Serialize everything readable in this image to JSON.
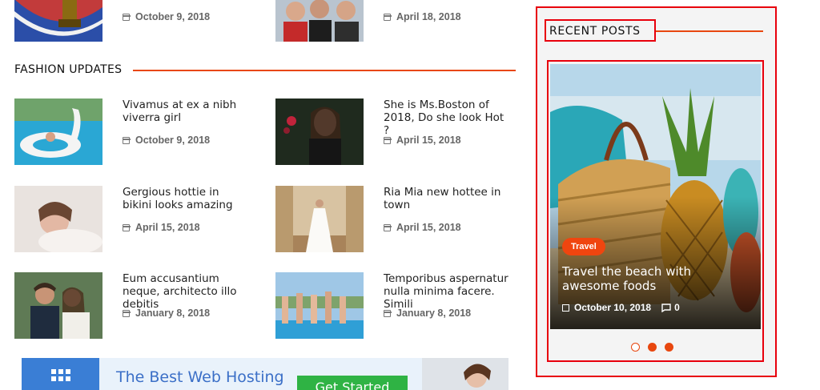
{
  "top_row": [
    {
      "date": "October 9, 2018"
    },
    {
      "date": "April 18, 2018"
    }
  ],
  "fashion": {
    "heading": "FASHION UPDATES",
    "posts": [
      {
        "title": "Vivamus at ex a nibh viverra girl",
        "date": "October 9, 2018"
      },
      {
        "title": "She is Ms.Boston of 2018, Do she look Hot ?",
        "date": "April 15, 2018"
      },
      {
        "title": "Gergious hottie in bikini looks amazing",
        "date": "April 15, 2018"
      },
      {
        "title": "Ria Mia new hottee in town",
        "date": "April 15, 2018"
      },
      {
        "title": "Eum accusantium neque, architecto illo debitis",
        "date": "January 8, 2018"
      },
      {
        "title": "Temporibus aspernatur nulla minima facere. Simili",
        "date": "January 8, 2018"
      }
    ]
  },
  "ad": {
    "text": "The Best Web Hosting",
    "button": "Get Started"
  },
  "sidebar": {
    "heading": "RECENT POSTS",
    "slide": {
      "category": "Travel",
      "title": "Travel the beach with awesome foods",
      "date": "October 10, 2018",
      "comments": "0"
    }
  },
  "colors": {
    "accent": "#e8470f",
    "highlight_box": "#e8000c"
  }
}
